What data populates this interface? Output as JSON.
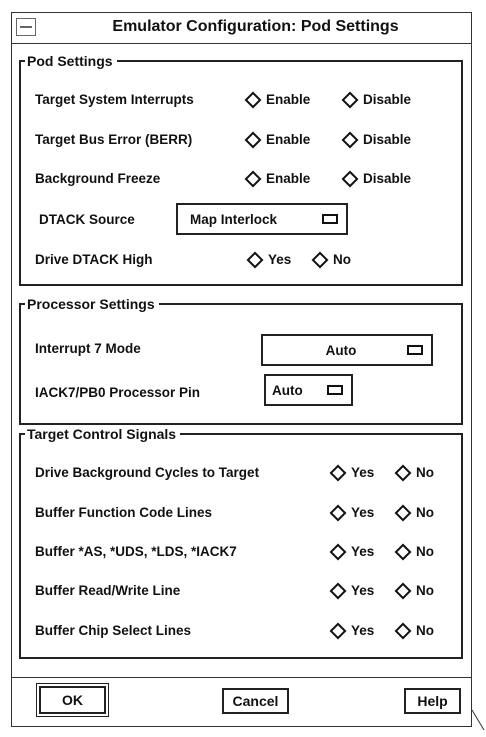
{
  "window": {
    "title": "Emulator Configuration: Pod Settings"
  },
  "pod": {
    "title": "Pod Settings",
    "rows": [
      {
        "label": "Target System Interrupts",
        "opt1": "Enable",
        "opt2": "Disable"
      },
      {
        "label": "Target Bus Error (BERR)",
        "opt1": "Enable",
        "opt2": "Disable"
      },
      {
        "label": "Background Freeze",
        "opt1": "Enable",
        "opt2": "Disable"
      }
    ],
    "dtack_source": {
      "label": "DTACK Source",
      "value": "Map Interlock"
    },
    "drive_dtack": {
      "label": "Drive DTACK High",
      "opt1": "Yes",
      "opt2": "No"
    }
  },
  "processor": {
    "title": "Processor Settings",
    "interrupt7": {
      "label": "Interrupt 7 Mode",
      "value": "Auto"
    },
    "iack7": {
      "label": "IACK7/PB0 Processor Pin",
      "value": "Auto"
    }
  },
  "target": {
    "title": "Target Control Signals",
    "rows": [
      {
        "label": "Drive Background Cycles to Target",
        "opt1": "Yes",
        "opt2": "No"
      },
      {
        "label": "Buffer Function Code Lines",
        "opt1": "Yes",
        "opt2": "No"
      },
      {
        "label": "Buffer *AS, *UDS, *LDS, *IACK7",
        "opt1": "Yes",
        "opt2": "No"
      },
      {
        "label": "Buffer Read/Write Line",
        "opt1": "Yes",
        "opt2": "No"
      },
      {
        "label": "Buffer Chip Select Lines",
        "opt1": "Yes",
        "opt2": "No"
      }
    ]
  },
  "buttons": {
    "ok": "OK",
    "cancel": "Cancel",
    "help": "Help"
  },
  "icons": {
    "system_menu": "system-menu-icon",
    "radio": "diamond-radio-icon",
    "dropdown": "dropdown-indicator-icon"
  }
}
